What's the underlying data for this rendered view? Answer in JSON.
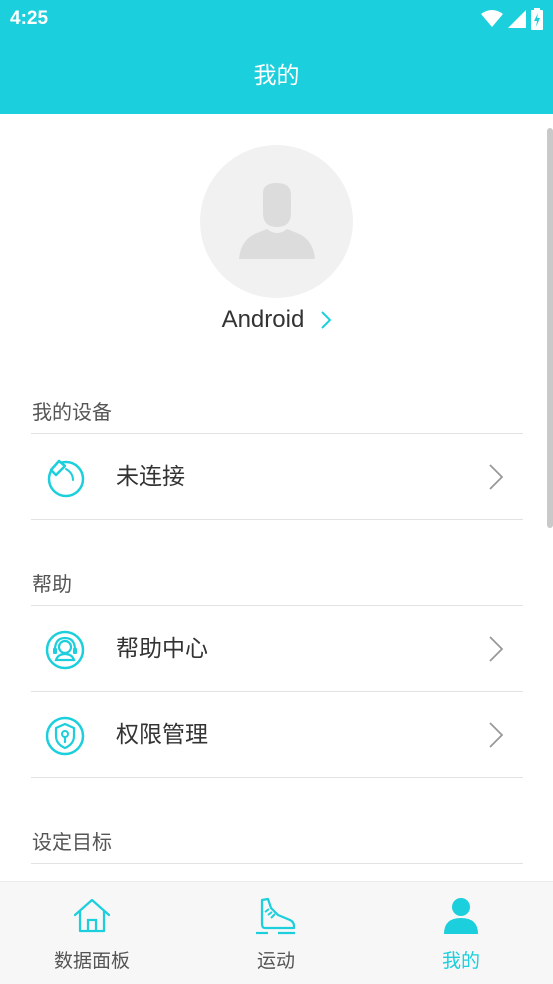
{
  "status_bar": {
    "time": "4:25"
  },
  "app_bar": {
    "title": "我的"
  },
  "profile": {
    "username": "Android"
  },
  "sections": {
    "devices": {
      "title": "我的设备",
      "items": [
        {
          "label": "未连接",
          "icon": "watch-icon"
        }
      ]
    },
    "help": {
      "title": "帮助",
      "items": [
        {
          "label": "帮助中心",
          "icon": "headset-support-icon"
        },
        {
          "label": "权限管理",
          "icon": "shield-lock-icon"
        }
      ]
    },
    "goals": {
      "title": "设定目标"
    }
  },
  "tab_bar": {
    "tabs": [
      {
        "label": "数据面板",
        "icon": "home-icon",
        "active": false
      },
      {
        "label": "运动",
        "icon": "sneaker-icon",
        "active": false
      },
      {
        "label": "我的",
        "icon": "person-icon",
        "active": true
      }
    ]
  },
  "colors": {
    "accent": "#1ccfdc",
    "tab_inactive": "#555555",
    "divider": "#e2e2e2"
  }
}
